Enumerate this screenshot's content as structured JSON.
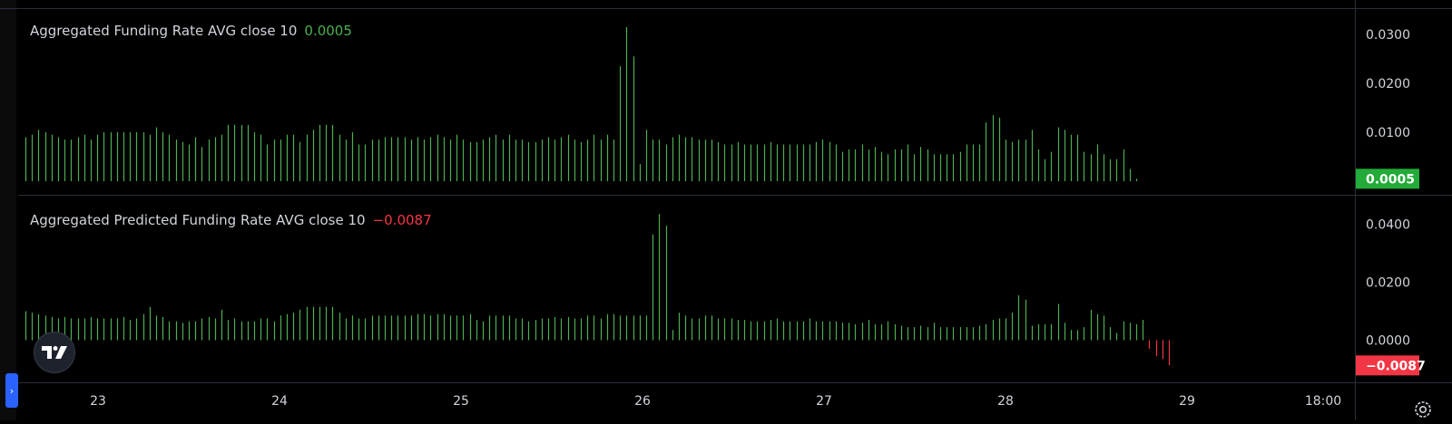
{
  "pane1": {
    "title": "Aggregated Funding Rate AVG close 10",
    "value": "0.0005",
    "value_color": "#4caf50"
  },
  "pane2": {
    "title": "Aggregated Predicted Funding Rate AVG close 10",
    "value": "−0.0087",
    "value_color": "#f23645"
  },
  "colors": {
    "up": "#4caf50",
    "down": "#f23645",
    "grid": "#2a2e39",
    "text": "#d1d4dc",
    "up_badge": "#22ab38",
    "down_badge": "#f23645"
  },
  "x_axis": {
    "ticks": [
      "23",
      "24",
      "25",
      "26",
      "27",
      "28",
      "29",
      "18:00"
    ]
  },
  "icons": {
    "logo": "tradingview-logo-icon",
    "settings": "gear-icon",
    "side_toggle": "chevron-right-icon"
  },
  "chart_data": [
    {
      "type": "bar",
      "title": "Aggregated Funding Rate AVG close 10",
      "last_value": 0.0005,
      "y_ticks": [
        "0.0300",
        "0.0200",
        "0.0100"
      ],
      "y_tick_values": [
        0.03,
        0.02,
        0.01
      ],
      "ylim": [
        0.0,
        0.034
      ],
      "badge": "0.0005",
      "x_start": 22.6,
      "x_step": 0.036,
      "values": [
        0.009,
        0.0095,
        0.0105,
        0.01,
        0.0095,
        0.009,
        0.0085,
        0.0085,
        0.009,
        0.0095,
        0.0085,
        0.0095,
        0.01,
        0.01,
        0.01,
        0.01,
        0.01,
        0.01,
        0.01,
        0.0095,
        0.011,
        0.01,
        0.0095,
        0.0085,
        0.008,
        0.0075,
        0.009,
        0.007,
        0.0085,
        0.009,
        0.0095,
        0.0115,
        0.0115,
        0.0115,
        0.0115,
        0.01,
        0.0095,
        0.0075,
        0.0085,
        0.0085,
        0.0095,
        0.0095,
        0.008,
        0.0095,
        0.0105,
        0.0115,
        0.0115,
        0.0115,
        0.0095,
        0.0085,
        0.01,
        0.0075,
        0.0075,
        0.0085,
        0.0085,
        0.009,
        0.009,
        0.009,
        0.009,
        0.0085,
        0.009,
        0.0085,
        0.009,
        0.0095,
        0.009,
        0.0085,
        0.0095,
        0.0085,
        0.008,
        0.008,
        0.0085,
        0.009,
        0.0095,
        0.0085,
        0.0095,
        0.0085,
        0.0085,
        0.008,
        0.008,
        0.0085,
        0.009,
        0.0085,
        0.009,
        0.0095,
        0.0085,
        0.008,
        0.0085,
        0.0095,
        0.0085,
        0.0095,
        0.0085,
        0.0235,
        0.0315,
        0.0255,
        0.0035,
        0.0105,
        0.0085,
        0.0085,
        0.0075,
        0.009,
        0.0095,
        0.009,
        0.009,
        0.0085,
        0.0085,
        0.0085,
        0.008,
        0.0075,
        0.0075,
        0.008,
        0.0075,
        0.0075,
        0.0075,
        0.0075,
        0.008,
        0.0075,
        0.0075,
        0.0075,
        0.0075,
        0.0075,
        0.0075,
        0.008,
        0.0085,
        0.008,
        0.0075,
        0.006,
        0.0065,
        0.0065,
        0.0075,
        0.0065,
        0.007,
        0.006,
        0.0055,
        0.0065,
        0.0065,
        0.0075,
        0.0055,
        0.007,
        0.0065,
        0.0055,
        0.0055,
        0.0055,
        0.0055,
        0.006,
        0.0075,
        0.0075,
        0.0075,
        0.012,
        0.0135,
        0.013,
        0.0085,
        0.008,
        0.0085,
        0.0085,
        0.0105,
        0.0065,
        0.0045,
        0.006,
        0.011,
        0.0105,
        0.0095,
        0.0095,
        0.006,
        0.0055,
        0.0075,
        0.0055,
        0.0045,
        0.0045,
        0.0065,
        0.0025,
        0.0005
      ]
    },
    {
      "type": "bar",
      "title": "Aggregated Predicted Funding Rate AVG close 10",
      "last_value": -0.0087,
      "y_ticks": [
        "0.0400",
        "0.0200",
        "0.0000"
      ],
      "y_tick_values": [
        0.04,
        0.02,
        0.0
      ],
      "ylim": [
        -0.0115,
        0.048
      ],
      "badge": "−0.0087",
      "x_start": 22.6,
      "x_step": 0.036,
      "values": [
        0.01,
        0.0095,
        0.009,
        0.0085,
        0.008,
        0.0075,
        0.008,
        0.0075,
        0.0075,
        0.0075,
        0.008,
        0.0075,
        0.0075,
        0.0075,
        0.0075,
        0.008,
        0.007,
        0.0075,
        0.009,
        0.0115,
        0.0085,
        0.008,
        0.0065,
        0.0065,
        0.006,
        0.0065,
        0.0065,
        0.0075,
        0.008,
        0.0075,
        0.0105,
        0.007,
        0.0075,
        0.0065,
        0.0065,
        0.0065,
        0.0075,
        0.0075,
        0.0065,
        0.0085,
        0.009,
        0.0095,
        0.0105,
        0.0115,
        0.0115,
        0.0115,
        0.0115,
        0.0115,
        0.0095,
        0.0075,
        0.0085,
        0.0075,
        0.0075,
        0.0085,
        0.0085,
        0.0085,
        0.0085,
        0.0085,
        0.0085,
        0.0085,
        0.009,
        0.009,
        0.0085,
        0.009,
        0.009,
        0.0085,
        0.0085,
        0.0085,
        0.009,
        0.007,
        0.0065,
        0.0085,
        0.0085,
        0.0085,
        0.0085,
        0.0075,
        0.0075,
        0.0065,
        0.007,
        0.0075,
        0.0075,
        0.008,
        0.0075,
        0.008,
        0.0075,
        0.0075,
        0.0085,
        0.0085,
        0.0075,
        0.009,
        0.009,
        0.0085,
        0.0085,
        0.0085,
        0.0085,
        0.0085,
        0.0365,
        0.0435,
        0.0395,
        0.0035,
        0.0095,
        0.0085,
        0.0075,
        0.0075,
        0.0085,
        0.0085,
        0.0075,
        0.0075,
        0.0075,
        0.007,
        0.007,
        0.0065,
        0.0065,
        0.0065,
        0.007,
        0.0075,
        0.0065,
        0.0065,
        0.0065,
        0.0065,
        0.0075,
        0.0065,
        0.0065,
        0.0065,
        0.0065,
        0.006,
        0.006,
        0.0055,
        0.006,
        0.007,
        0.0055,
        0.0055,
        0.0065,
        0.0055,
        0.005,
        0.0045,
        0.0045,
        0.005,
        0.0045,
        0.006,
        0.0045,
        0.0045,
        0.0045,
        0.0045,
        0.0045,
        0.0045,
        0.005,
        0.0055,
        0.007,
        0.0075,
        0.0075,
        0.0095,
        0.0155,
        0.014,
        0.005,
        0.0055,
        0.0055,
        0.0055,
        0.0125,
        0.006,
        0.0035,
        0.0035,
        0.0045,
        0.0105,
        0.009,
        0.0085,
        0.0045,
        0.0025,
        0.0065,
        0.006,
        0.0055,
        0.007,
        -0.003,
        -0.0055,
        -0.0065,
        -0.0087
      ]
    }
  ]
}
